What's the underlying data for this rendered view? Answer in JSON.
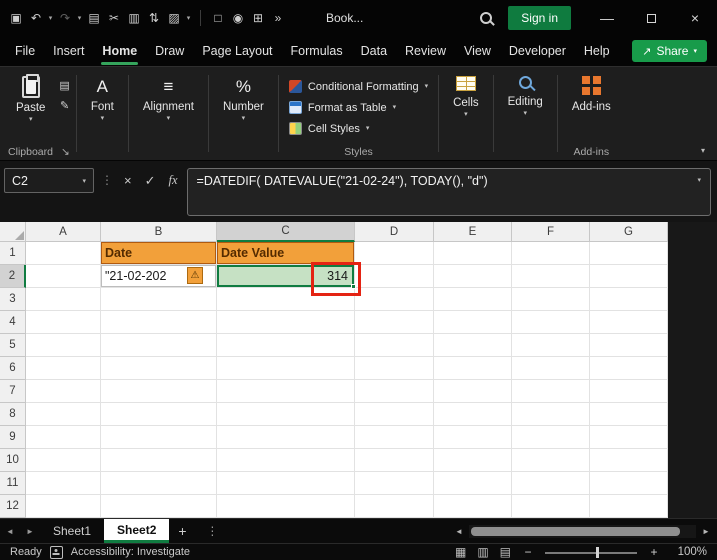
{
  "titlebar": {
    "workbook_name": "Book...",
    "signin_label": "Sign in"
  },
  "glyphs": {
    "save": "▣",
    "undo": "↶",
    "redo": "↷",
    "chevron": "▾",
    "copy": "▤",
    "cut": "✂",
    "chart": "▥",
    "sort": "⇅",
    "fill_color": "▨",
    "format_painter": "✎",
    "document": "□",
    "camera": "◉",
    "borders": "⊞",
    "overflow": "»",
    "minimize": "—",
    "close": "×",
    "share_arrow": "↗",
    "font": "A",
    "alignment": "≡",
    "number": "%",
    "dots": "⋮",
    "cancel": "×",
    "enter": "✓",
    "fx": "fx",
    "launcher": "↘",
    "collapse": "▾",
    "nav_left": "◄",
    "nav_right": "►",
    "add_sheet": "+",
    "warning": "⚠",
    "view_normal": "▦",
    "view_layout": "▥",
    "view_break": "▤"
  },
  "menubar": {
    "tabs": [
      "File",
      "Insert",
      "Home",
      "Draw",
      "Page Layout",
      "Formulas",
      "Data",
      "Review",
      "View",
      "Developer",
      "Help"
    ],
    "active_tab": "Home",
    "share_label": "Share"
  },
  "ribbon": {
    "paste_label": "Paste",
    "clipboard_group_label": "Clipboard",
    "font_label": "Font",
    "alignment_label": "Alignment",
    "number_label": "Number",
    "conditional_formatting_label": "Conditional Formatting",
    "format_as_table_label": "Format as Table",
    "cell_styles_label": "Cell Styles",
    "styles_group_label": "Styles",
    "cells_label": "Cells",
    "editing_label": "Editing",
    "addins_label": "Add-ins",
    "addins_group_label": "Add-ins"
  },
  "formula_bar": {
    "name_box_value": "C2",
    "formula": "=DATEDIF( DATEVALUE(\"21-02-24\"), TODAY(), \"d\")"
  },
  "grid": {
    "column_headers": [
      "A",
      "B",
      "C",
      "D",
      "E",
      "F",
      "G"
    ],
    "row_headers": [
      "1",
      "2",
      "3",
      "4",
      "5",
      "6",
      "7",
      "8",
      "9",
      "10",
      "11",
      "12"
    ],
    "cells": {
      "B1": "Date",
      "C1": "Date Value",
      "B2": "\"21-02-202",
      "C2": "314"
    }
  },
  "sheet_tabs": {
    "tabs": [
      "Sheet1",
      "Sheet2"
    ],
    "active_tab": "Sheet2"
  },
  "status_bar": {
    "mode": "Ready",
    "accessibility_label": "Accessibility: Investigate",
    "zoom_out": "−",
    "zoom_in": "+",
    "zoom_level": "100%"
  }
}
